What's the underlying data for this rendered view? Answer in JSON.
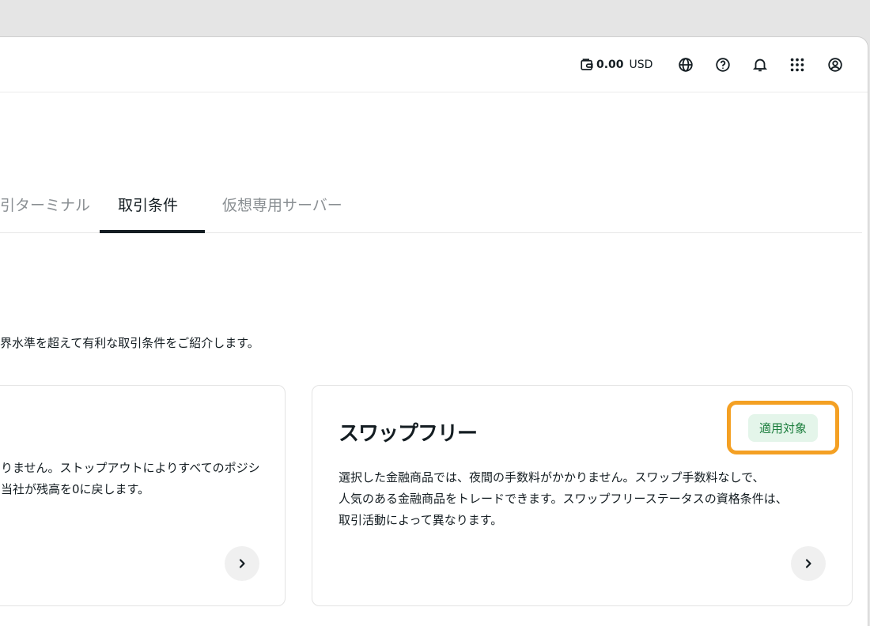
{
  "header": {
    "balance_amount": "0.00",
    "balance_currency": "USD",
    "icons": [
      "wallet-icon",
      "globe-icon",
      "help-icon",
      "bell-icon",
      "apps-grid-icon",
      "account-icon"
    ]
  },
  "tabs": [
    {
      "label": "引ターミナル",
      "active": false
    },
    {
      "label": "取引条件",
      "active": true
    },
    {
      "label": "仮想専用サーバー",
      "active": false
    }
  ],
  "intro_text": "界水準を超えて有利な取引条件をご紹介します。",
  "cards": {
    "left": {
      "line1": "りません。ストップアウトによりすべてのポジシ",
      "line2": "当社が残高を0に戻します。"
    },
    "right": {
      "title": "スワップフリー",
      "badge": "適用対象",
      "line1": "選択した金融商品では、夜間の手数料がかかりません。スワップ手数料なしで、",
      "line2": "人気のある金融商品をトレードできます。スワップフリーステータスの資格条件は、",
      "line3": "取引活動によって異なります。"
    }
  }
}
